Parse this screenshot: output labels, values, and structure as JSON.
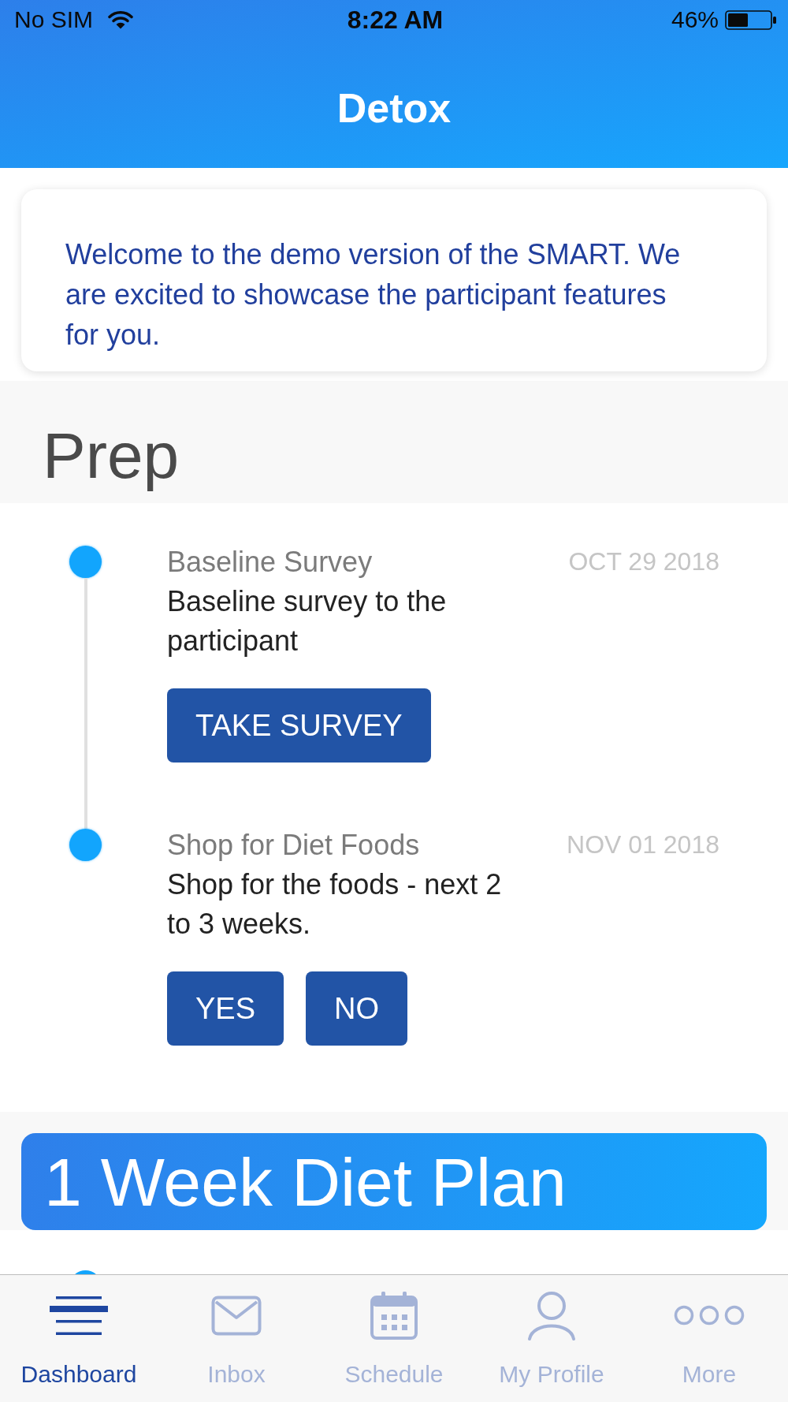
{
  "status_bar": {
    "carrier": "No SIM",
    "time": "8:22 AM",
    "battery": "46%"
  },
  "header": {
    "title": "Detox"
  },
  "welcome_card": {
    "text": "Welcome to the demo version of the SMART. We are excited to showcase the participant features for you."
  },
  "sections": [
    {
      "kind": "heading",
      "title": "Prep",
      "events": [
        {
          "title": "Baseline Survey",
          "date": "OCT 29 2018",
          "description": "Baseline survey to the participant",
          "actions": [
            "TAKE SURVEY"
          ]
        },
        {
          "title": "Shop for Diet Foods",
          "date": "NOV 01 2018",
          "description": "Shop for the foods - next 2 to 3 weeks.",
          "actions": [
            "YES",
            "NO"
          ]
        }
      ]
    },
    {
      "kind": "banner",
      "title": "1 Week Diet Plan"
    }
  ],
  "tab_bar": {
    "tabs": [
      {
        "label": "Dashboard",
        "selected": true
      },
      {
        "label": "Inbox",
        "selected": false
      },
      {
        "label": "Schedule",
        "selected": false
      },
      {
        "label": "My Profile",
        "selected": false
      },
      {
        "label": "More",
        "selected": false
      }
    ]
  }
}
